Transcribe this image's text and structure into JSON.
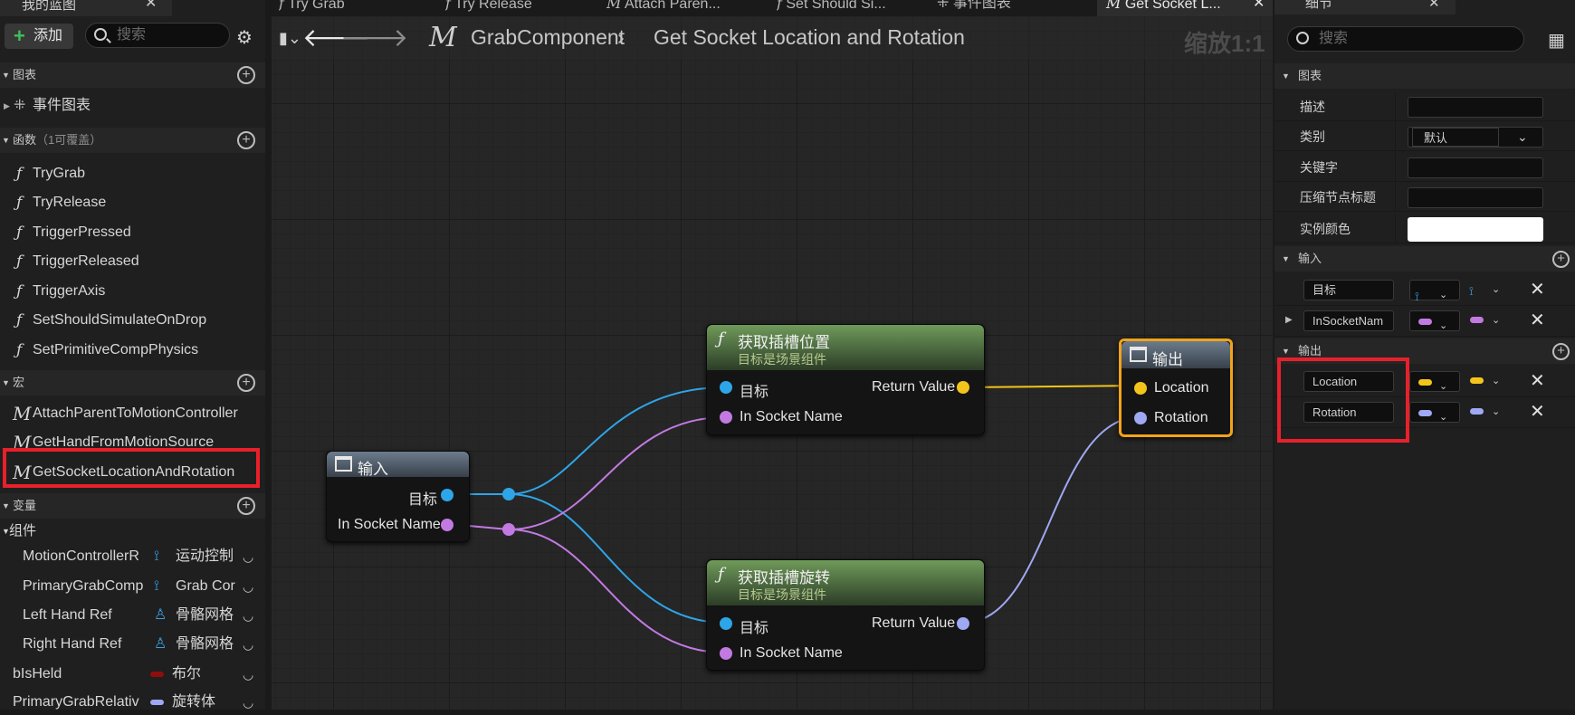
{
  "left_panel": {
    "tab_title": "我的蓝图",
    "add_label": "添加",
    "search_placeholder": "搜索",
    "sections": {
      "graphs": "图表",
      "functions": "函数",
      "functions_note": "（1可覆盖）",
      "macros": "宏",
      "variables": "变量",
      "components": "组件"
    },
    "event_graph": "事件图表",
    "functions": [
      "TryGrab",
      "TryRelease",
      "TriggerPressed",
      "TriggerReleased",
      "TriggerAxis",
      "SetShouldSimulateOnDrop",
      "SetPrimitiveCompPhysics"
    ],
    "macros": [
      "AttachParentToMotionController",
      "GetHandFromMotionSource",
      "GetSocketLocationAndRotation"
    ],
    "components": [
      {
        "name": "MotionControllerR",
        "type": "运动控制"
      },
      {
        "name": "PrimaryGrabComp",
        "type": "Grab Cor"
      },
      {
        "name": "Left Hand Ref",
        "type": "骨骼网格"
      },
      {
        "name": "Right Hand Ref",
        "type": "骨骼网格"
      }
    ],
    "variables": [
      {
        "name": "bIsHeld",
        "type": "布尔",
        "color": "#8f0d0d"
      },
      {
        "name": "PrimaryGrabRelativ",
        "type": "旋转体",
        "color": "#9fa8f2"
      }
    ]
  },
  "graph": {
    "tabs": [
      "Try Grab",
      "Try Release",
      "Attach Paren...",
      "Set Should Si...",
      "事件图表",
      "Get Socket L..."
    ],
    "breadcrumb_root": "GrabComponent",
    "breadcrumb_current": "Get Socket Location and Rotation",
    "zoom": "缩放1:1",
    "nodes": {
      "input": {
        "title": "输入",
        "pins": [
          "目标",
          "In Socket Name"
        ]
      },
      "get_location": {
        "title": "获取插槽位置",
        "subtitle": "目标是场景组件",
        "in_pins": [
          "目标",
          "In Socket Name"
        ],
        "out_pin": "Return Value"
      },
      "get_rotation": {
        "title": "获取插槽旋转",
        "subtitle": "目标是场景组件",
        "in_pins": [
          "目标",
          "In Socket Name"
        ],
        "out_pin": "Return Value"
      },
      "output": {
        "title": "输出",
        "pins": [
          "Location",
          "Rotation"
        ]
      }
    },
    "pin_colors": {
      "object": "#2ea5e8",
      "name": "#c27ae2",
      "vector": "#f3c51c",
      "rotator": "#9fa8f2"
    }
  },
  "details": {
    "tab_title": "细节",
    "search_placeholder": "搜索",
    "graph_section": "图表",
    "fields": [
      {
        "label": "描述",
        "value": ""
      },
      {
        "label": "类别",
        "value": "默认"
      },
      {
        "label": "关键字",
        "value": ""
      },
      {
        "label": "压缩节点标题",
        "value": ""
      },
      {
        "label": "实例颜色",
        "value": ""
      }
    ],
    "inputs_section": "输入",
    "inputs": [
      "目标",
      "InSocketNam"
    ],
    "outputs_section": "输出",
    "outputs": [
      "Location",
      "Rotation"
    ]
  },
  "highlight_color": "#e8202a"
}
